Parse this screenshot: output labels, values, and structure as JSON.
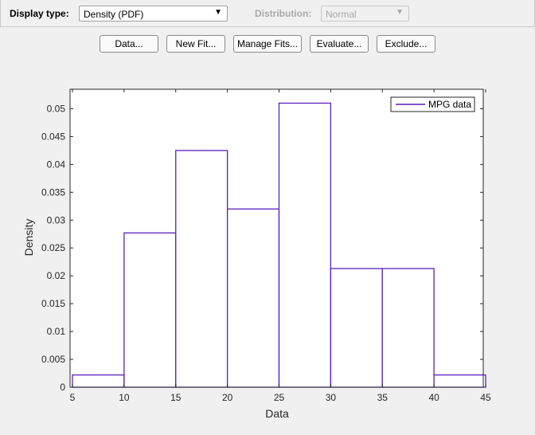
{
  "toolbar": {
    "display_type_label": "Display type:",
    "display_type_value": "Density (PDF)",
    "distribution_label": "Distribution:",
    "distribution_value": "Normal",
    "arrow_glyph": "▼"
  },
  "buttons": {
    "data": "Data...",
    "new_fit": "New Fit...",
    "manage_fits": "Manage Fits...",
    "evaluate": "Evaluate...",
    "exclude": "Exclude..."
  },
  "colors": {
    "series": "#5b1fbf",
    "axes": "#262626",
    "grid_bg": "#ffffff"
  },
  "chart_data": {
    "type": "bar",
    "bin_edges": [
      5,
      10,
      15,
      20,
      25,
      30,
      35,
      40,
      45
    ],
    "values": [
      0.0022,
      0.0277,
      0.0425,
      0.032,
      0.051,
      0.0213,
      0.0213,
      0.0022
    ],
    "xlabel": "Data",
    "ylabel": "Density",
    "xlim": [
      5,
      45
    ],
    "ylim": [
      0,
      0.0535
    ],
    "xticks": [
      "5",
      "10",
      "15",
      "20",
      "25",
      "30",
      "35",
      "40",
      "45"
    ],
    "yticks": [
      "0",
      "0.005",
      "0.01",
      "0.015",
      "0.02",
      "0.025",
      "0.03",
      "0.035",
      "0.04",
      "0.045",
      "0.05"
    ],
    "legend": {
      "entries": [
        "MPG data"
      ],
      "position": "top-right"
    },
    "grid": false
  }
}
